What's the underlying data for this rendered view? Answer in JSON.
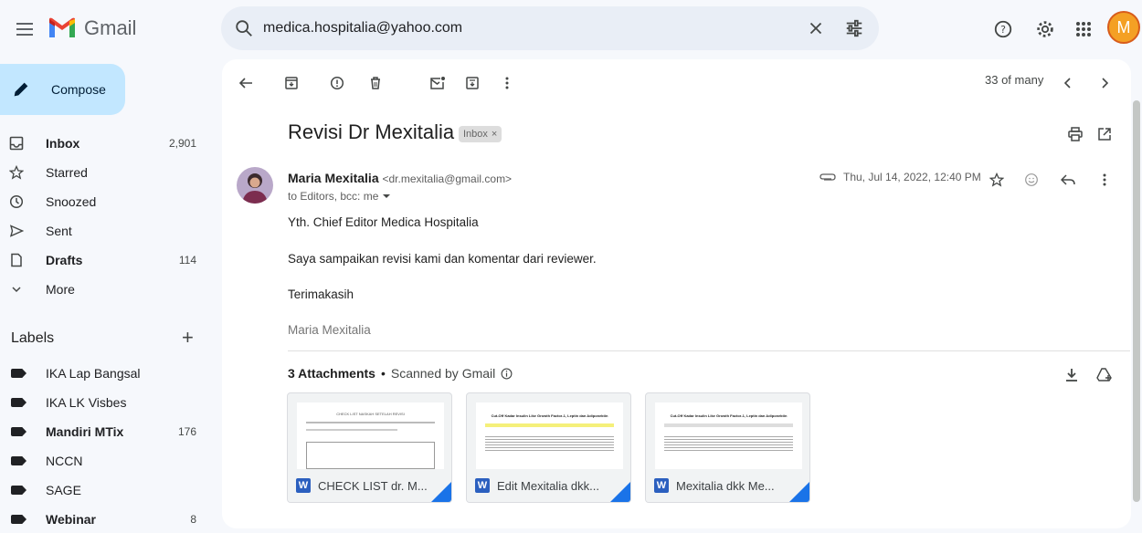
{
  "app": {
    "name": "Gmail"
  },
  "header": {
    "search_value": "medica.hospitalia@yahoo.com",
    "avatar_letter": "M"
  },
  "sidebar": {
    "compose_label": "Compose",
    "items": [
      {
        "label": "Inbox",
        "count": "2,901",
        "icon": "inbox-icon"
      },
      {
        "label": "Starred",
        "count": "",
        "icon": "star-icon"
      },
      {
        "label": "Snoozed",
        "count": "",
        "icon": "clock-icon"
      },
      {
        "label": "Sent",
        "count": "",
        "icon": "send-icon"
      },
      {
        "label": "Drafts",
        "count": "114",
        "icon": "draft-icon"
      },
      {
        "label": "More",
        "count": "",
        "icon": "chevron-down-icon"
      }
    ],
    "labels_title": "Labels",
    "labels": [
      {
        "label": "IKA Lap Bangsal",
        "count": ""
      },
      {
        "label": "IKA LK Visbes",
        "count": ""
      },
      {
        "label": "Mandiri MTix",
        "count": "176"
      },
      {
        "label": "NCCN",
        "count": ""
      },
      {
        "label": "SAGE",
        "count": ""
      },
      {
        "label": "Webinar",
        "count": "8"
      }
    ]
  },
  "toolbar": {
    "pager": "33 of many"
  },
  "email": {
    "subject": "Revisi Dr Mexitalia",
    "badge": "Inbox",
    "sender_name": "Maria Mexitalia",
    "sender_email": "<dr.mexitalia@gmail.com>",
    "recipients": "to Editors, bcc: me",
    "date": "Thu, Jul 14, 2022, 12:40 PM",
    "body": [
      "Yth. Chief Editor Medica Hospitalia",
      "Saya sampaikan revisi kami dan komentar dari reviewer.",
      "Terimakasih",
      "Maria Mexitalia"
    ]
  },
  "attachments": {
    "title": "3 Attachments",
    "scanned": "Scanned by Gmail",
    "files": [
      {
        "name": "CHECK LIST dr. M...",
        "preview_title": "CHECK LIST NASKAH SETELAH REVISI",
        "type": "W"
      },
      {
        "name": "Edit Mexitalia dkk...",
        "preview_title": "Cut-Off Kadar Insulin Like Growth Factor-1, Leptin dan Adiponektin",
        "type": "W"
      },
      {
        "name": "Mexitalia dkk Me...",
        "preview_title": "Cut-Off Kadar Insulin Like Growth Factor-1, Leptin dan Adiponektin",
        "type": "W"
      }
    ]
  },
  "colors": {
    "accent": "#c2e7ff",
    "word_blue": "#2b5fbf"
  }
}
